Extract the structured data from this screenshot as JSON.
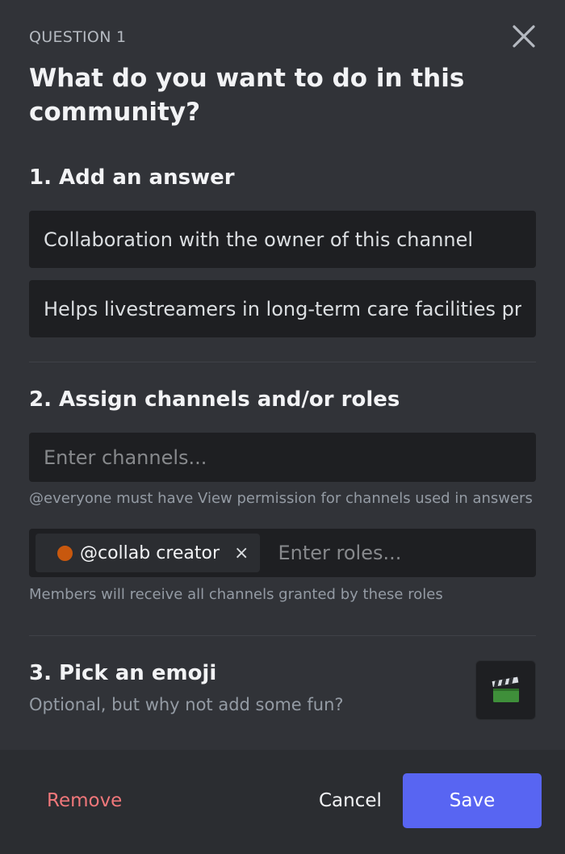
{
  "header": {
    "eyebrow": "QUESTION 1",
    "title": "What do you want to do in this community?"
  },
  "answers": {
    "heading": "1. Add an answer",
    "items": [
      {
        "value": "Collaboration with the owner of this channel"
      },
      {
        "value": "Helps livestreamers in long-term care facilities prepare"
      }
    ]
  },
  "assign": {
    "heading": "2. Assign channels and/or roles",
    "channels_placeholder": "Enter channels...",
    "channels_hint": "@everyone must have View permission for channels used in answers",
    "roles": [
      {
        "name": "@collab creator",
        "color": "#c8580e",
        "remove_icon": "×"
      }
    ],
    "roles_placeholder": "Enter roles...",
    "roles_hint": "Members will receive all channels granted by these roles"
  },
  "emoji": {
    "heading": "3. Pick an emoji",
    "subtitle": "Optional, but why not add some fun?",
    "selected_icon": "clapper-board-icon"
  },
  "footer": {
    "remove_label": "Remove",
    "cancel_label": "Cancel",
    "save_label": "Save"
  },
  "colors": {
    "accent": "#5865f2",
    "danger": "#f0777a",
    "background": "#313338",
    "input": "#1e1f22"
  }
}
